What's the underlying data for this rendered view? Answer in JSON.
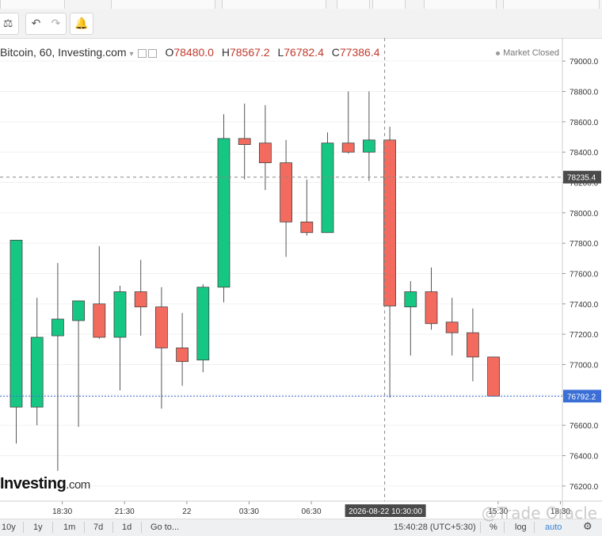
{
  "legend": {
    "symbol": "Bitcoin, 60, Investing.com",
    "open_label": "O",
    "open": "78480.0",
    "high_label": "H",
    "high": "78567.2",
    "low_label": "L",
    "low": "76782.4",
    "close_label": "C",
    "close": "77386.4",
    "status": "Market Closed"
  },
  "brand": {
    "name": "Investing",
    "suffix": ".com"
  },
  "toolbar": {
    "icons": [
      "scale-icon",
      "undo-icon",
      "redo-icon",
      "alert-icon"
    ]
  },
  "colors": {
    "up": "#16c784",
    "down": "#f26b5e",
    "axis_text": "#333333",
    "grid": "#f0f0f0",
    "crosshair": "#888888",
    "last_price_line": "#3b6fd6"
  },
  "bottom": {
    "ranges": [
      "10y",
      "1y",
      "1m",
      "7d",
      "1d"
    ],
    "goto": "Go to...",
    "clock": "15:40:28 (UTC+5:30)",
    "percent": "%",
    "log": "log",
    "auto": "auto"
  },
  "watermark": "@Trade Oracle",
  "chart_data": {
    "type": "candlestick",
    "title": "Bitcoin, 60, Investing.com",
    "ylim": [
      76100,
      79100
    ],
    "y_ticks": [
      76200,
      76400,
      76600,
      76800,
      77000,
      77200,
      77400,
      77600,
      77800,
      78000,
      78200,
      78400,
      78600,
      78800,
      79000
    ],
    "y_tick_labels": [
      "76200.0",
      "76400.0",
      "76600.0",
      "76800.0",
      "77000.0",
      "77200.0",
      "77400.0",
      "77600.0",
      "77800.0",
      "78000.0",
      "78200.0",
      "78400.0",
      "78600.0",
      "78800.0",
      "79000.0"
    ],
    "x_tick_labels": [
      "18:30",
      "21:30",
      "22",
      "03:30",
      "06:30",
      "15:30",
      "18:30"
    ],
    "x_tick_index": [
      2.2,
      5.2,
      8.2,
      11.2,
      14.2,
      23.2,
      26.2
    ],
    "crosshair_price": "78235.4",
    "crosshair_time": "2026-08-22 10:30:00",
    "crosshair_index": 18,
    "last_price": "76792.2",
    "last_value": 76792.2,
    "crosshair_value": 78235.4,
    "candles": [
      {
        "o": 76720,
        "h": 77820,
        "l": 76480,
        "c": 77820
      },
      {
        "o": 76720,
        "h": 77440,
        "l": 76600,
        "c": 77180
      },
      {
        "o": 77190,
        "h": 77670,
        "l": 76300,
        "c": 77300
      },
      {
        "o": 77290,
        "h": 77420,
        "l": 76590,
        "c": 77420
      },
      {
        "o": 77400,
        "h": 77780,
        "l": 77170,
        "c": 77180
      },
      {
        "o": 77180,
        "h": 77520,
        "l": 76830,
        "c": 77480
      },
      {
        "o": 77480,
        "h": 77690,
        "l": 77190,
        "c": 77380
      },
      {
        "o": 77380,
        "h": 77510,
        "l": 76710,
        "c": 77110
      },
      {
        "o": 77110,
        "h": 77340,
        "l": 76860,
        "c": 77020
      },
      {
        "o": 77030,
        "h": 77530,
        "l": 76950,
        "c": 77510
      },
      {
        "o": 77510,
        "h": 78650,
        "l": 77410,
        "c": 78490
      },
      {
        "o": 78490,
        "h": 78720,
        "l": 78220,
        "c": 78450
      },
      {
        "o": 78460,
        "h": 78710,
        "l": 78150,
        "c": 78330
      },
      {
        "o": 78330,
        "h": 78480,
        "l": 77710,
        "c": 77940
      },
      {
        "o": 77940,
        "h": 78220,
        "l": 77850,
        "c": 77870
      },
      {
        "o": 77870,
        "h": 78530,
        "l": 77870,
        "c": 78460
      },
      {
        "o": 78460,
        "h": 78800,
        "l": 78390,
        "c": 78400
      },
      {
        "o": 78400,
        "h": 78800,
        "l": 78210,
        "c": 78480
      },
      {
        "o": 78480,
        "h": 78567.2,
        "l": 76782.4,
        "c": 77386.4
      },
      {
        "o": 77380,
        "h": 77550,
        "l": 77060,
        "c": 77480
      },
      {
        "o": 77480,
        "h": 77640,
        "l": 77230,
        "c": 77270
      },
      {
        "o": 77280,
        "h": 77440,
        "l": 77060,
        "c": 77210
      },
      {
        "o": 77210,
        "h": 77370,
        "l": 76890,
        "c": 77050
      },
      {
        "o": 77050,
        "h": 77050,
        "l": 76790,
        "c": 76792.2
      }
    ]
  }
}
